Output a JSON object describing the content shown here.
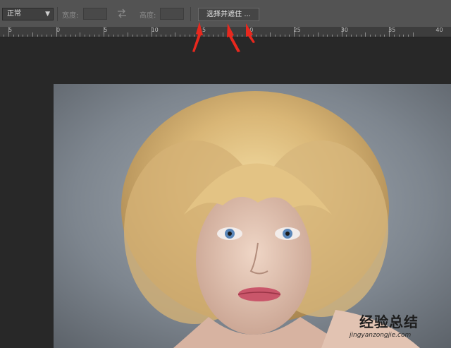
{
  "options_bar": {
    "mode_value": "正常",
    "width_label": "宽度:",
    "width_value": "",
    "height_label": "高度:",
    "height_value": "",
    "select_and_mask_label": "选择并遮住 ..."
  },
  "ruler": {
    "labels": [
      "5",
      "0",
      "5",
      "10",
      "15",
      "20",
      "25",
      "30",
      "35",
      "40"
    ]
  },
  "canvas": {
    "image_subject": "blonde-bob-haired-woman-portrait"
  },
  "watermark": {
    "chinese_text": "经验总结",
    "url_text": "jingyanzongjie.com"
  },
  "colors": {
    "annotation_arrow": "#e8281e",
    "panel_bg": "#535353",
    "workspace_bg": "#282828"
  }
}
